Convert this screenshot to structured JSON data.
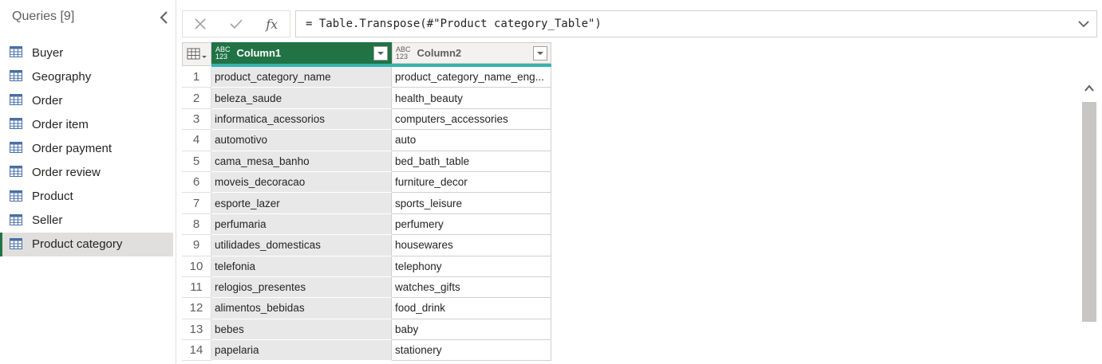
{
  "queries": {
    "header": "Queries [9]",
    "items": [
      {
        "label": "Buyer"
      },
      {
        "label": "Geography"
      },
      {
        "label": "Order"
      },
      {
        "label": "Order item"
      },
      {
        "label": "Order payment"
      },
      {
        "label": "Order review"
      },
      {
        "label": "Product"
      },
      {
        "label": "Seller"
      },
      {
        "label": "Product category"
      }
    ],
    "active_index": 8
  },
  "formula": {
    "cancel_icon": "close-icon",
    "commit_icon": "check-icon",
    "fx_label": "fx",
    "text": "= Table.Transpose(#\"Product category_Table\")"
  },
  "table": {
    "type_badge": [
      "ABC",
      "123"
    ],
    "columns": [
      {
        "label": "Column1"
      },
      {
        "label": "Column2"
      }
    ],
    "rows": [
      {
        "n": "1",
        "c1": "product_category_name",
        "c2": "product_category_name_eng..."
      },
      {
        "n": "2",
        "c1": "beleza_saude",
        "c2": "health_beauty"
      },
      {
        "n": "3",
        "c1": "informatica_acessorios",
        "c2": "computers_accessories"
      },
      {
        "n": "4",
        "c1": "automotivo",
        "c2": "auto"
      },
      {
        "n": "5",
        "c1": "cama_mesa_banho",
        "c2": "bed_bath_table"
      },
      {
        "n": "6",
        "c1": "moveis_decoracao",
        "c2": "furniture_decor"
      },
      {
        "n": "7",
        "c1": "esporte_lazer",
        "c2": "sports_leisure"
      },
      {
        "n": "8",
        "c1": "perfumaria",
        "c2": "perfumery"
      },
      {
        "n": "9",
        "c1": "utilidades_domesticas",
        "c2": "housewares"
      },
      {
        "n": "10",
        "c1": "telefonia",
        "c2": "telephony"
      },
      {
        "n": "11",
        "c1": "relogios_presentes",
        "c2": "watches_gifts"
      },
      {
        "n": "12",
        "c1": "alimentos_bebidas",
        "c2": "food_drink"
      },
      {
        "n": "13",
        "c1": "bebes",
        "c2": "baby"
      },
      {
        "n": "14",
        "c1": "papelaria",
        "c2": "stationery"
      }
    ]
  },
  "colors": {
    "accent": "#217346",
    "quality_bar": "#38b2ac",
    "selected_column_bg": "#e8e8e8"
  }
}
